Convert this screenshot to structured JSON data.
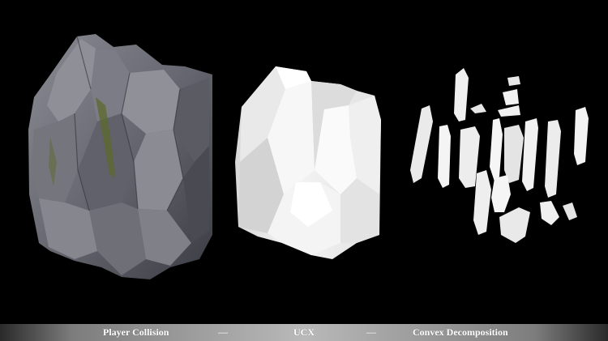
{
  "captions": {
    "left": "Player Collision",
    "separator_1": "—",
    "middle": "UCX",
    "separator_2": "—",
    "right": "Convex Decomposition"
  },
  "colors": {
    "background": "#000000",
    "rock_dark": "#3b3c43",
    "rock_mid": "#6a6b74",
    "rock_light": "#9a9aa0",
    "moss": "#5b6a2e",
    "collision_white": "#f2f2f2",
    "collision_shade": "#c9c9c9",
    "caption_text": "#ffffff"
  }
}
